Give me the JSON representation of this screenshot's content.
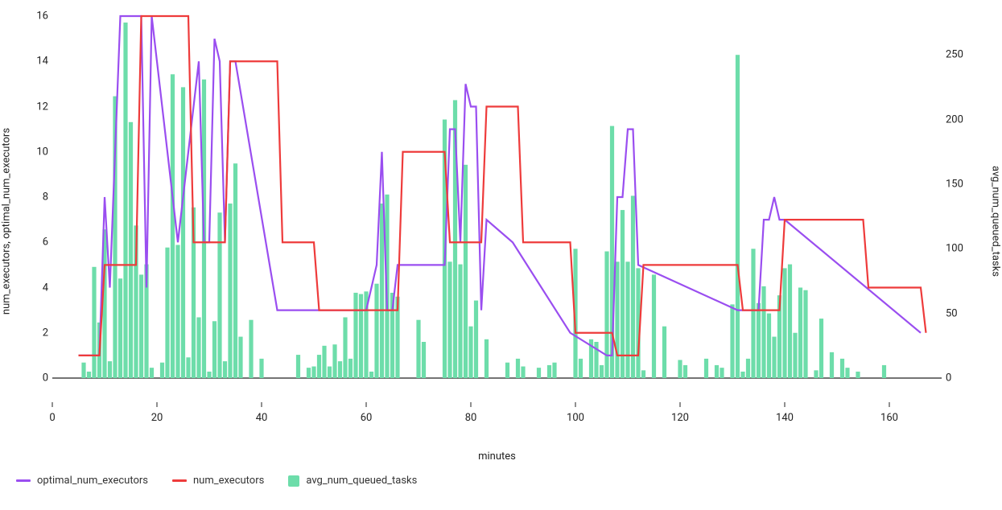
{
  "chart_data": {
    "type": "combo",
    "xlabel": "minutes",
    "ylabel_left": "num_executors, optimal_num_executors",
    "ylabel_right": "avg_num_queued_tasks",
    "y_left": {
      "min": 0,
      "max": 16,
      "ticks": [
        0,
        2,
        4,
        6,
        8,
        10,
        12,
        14,
        16
      ]
    },
    "y_right": {
      "min": 0,
      "max": 280,
      "ticks": [
        0,
        50,
        100,
        150,
        200,
        250
      ]
    },
    "x": {
      "min": 0,
      "max": 170,
      "ticks": [
        0,
        20,
        40,
        60,
        80,
        100,
        120,
        140,
        160
      ]
    },
    "series": [
      {
        "name": "avg_num_queued_tasks",
        "type": "bar",
        "axis": "right",
        "color": "#6dddaa",
        "x": [
          5,
          6,
          7,
          8,
          9,
          10,
          11,
          12,
          13,
          14,
          15,
          16,
          17,
          18,
          19,
          20,
          21,
          22,
          23,
          24,
          25,
          26,
          27,
          28,
          29,
          30,
          31,
          32,
          33,
          34,
          35,
          36,
          37,
          38,
          39,
          40,
          41,
          42,
          43,
          44,
          45,
          46,
          47,
          48,
          49,
          50,
          51,
          52,
          53,
          54,
          55,
          56,
          57,
          58,
          59,
          60,
          61,
          62,
          63,
          64,
          65,
          66,
          67,
          68,
          69,
          70,
          71,
          72,
          73,
          74,
          75,
          76,
          77,
          78,
          79,
          80,
          81,
          82,
          83,
          84,
          85,
          86,
          87,
          88,
          89,
          90,
          91,
          92,
          93,
          94,
          95,
          96,
          97,
          98,
          99,
          100,
          101,
          102,
          103,
          104,
          105,
          106,
          107,
          108,
          109,
          110,
          111,
          112,
          113,
          114,
          115,
          116,
          117,
          118,
          119,
          120,
          121,
          122,
          123,
          124,
          125,
          126,
          127,
          128,
          129,
          130,
          131,
          132,
          133,
          134,
          135,
          136,
          137,
          138,
          139,
          140,
          141,
          142,
          143,
          144,
          145,
          146,
          147,
          148,
          149,
          150,
          151,
          152,
          153,
          154,
          155,
          156,
          157,
          158,
          159,
          160
        ],
        "values": [
          0,
          12,
          5,
          86,
          43,
          115,
          13,
          218,
          77,
          275,
          198,
          118,
          80,
          88,
          8,
          0,
          12,
          101,
          235,
          103,
          225,
          16,
          132,
          47,
          231,
          5,
          44,
          128,
          13,
          135,
          166,
          32,
          0,
          45,
          0,
          15,
          0,
          0,
          0,
          0,
          0,
          0,
          18,
          0,
          8,
          9,
          18,
          25,
          9,
          26,
          13,
          47,
          15,
          66,
          65,
          67,
          5,
          73,
          135,
          142,
          66,
          63,
          0,
          0,
          0,
          45,
          28,
          0,
          0,
          0,
          200,
          90,
          215,
          88,
          165,
          40,
          60,
          0,
          30,
          0,
          0,
          0,
          12,
          0,
          15,
          9,
          0,
          0,
          8,
          0,
          10,
          12,
          0,
          0,
          0,
          100,
          15,
          0,
          30,
          28,
          10,
          98,
          195,
          90,
          130,
          90,
          141,
          85,
          6,
          0,
          80,
          0,
          40,
          0,
          0,
          14,
          10,
          0,
          0,
          0,
          15,
          0,
          10,
          8,
          0,
          57,
          250,
          5,
          15,
          100,
          58,
          71,
          50,
          32,
          64,
          85,
          88,
          35,
          70,
          68,
          0,
          6,
          46,
          0,
          20,
          0,
          15,
          8,
          0,
          5,
          0,
          0,
          0,
          0,
          10,
          0
        ]
      },
      {
        "name": "optimal_num_executors",
        "type": "line",
        "axis": "left",
        "color": "#9a4ef0",
        "x": [
          5,
          9,
          10,
          11,
          13,
          15,
          16,
          17,
          18,
          19,
          24,
          28,
          29,
          30,
          31,
          32,
          33,
          34,
          35,
          43,
          60,
          62,
          63,
          64,
          65,
          66,
          75,
          76,
          77,
          78,
          79,
          80,
          81,
          82,
          83,
          88,
          99,
          106,
          107,
          108,
          109,
          110,
          111,
          112,
          131,
          135,
          136,
          137,
          138,
          139,
          140,
          166
        ],
        "values": [
          1,
          1,
          8,
          4,
          16,
          16,
          16,
          16,
          4,
          16,
          6,
          14,
          6,
          6,
          15,
          14,
          6,
          14,
          14,
          3,
          3,
          5,
          10,
          3,
          3,
          5,
          5,
          11,
          11,
          6,
          13,
          12,
          12,
          3,
          7,
          6,
          2,
          1,
          1,
          8,
          8,
          11,
          11,
          5,
          3,
          3,
          7,
          7,
          8,
          7,
          7,
          2
        ]
      },
      {
        "name": "num_executors",
        "type": "line",
        "axis": "left",
        "color": "#ee3b3b",
        "x": [
          5,
          6,
          7,
          8,
          9,
          10,
          11,
          16,
          17,
          26,
          27,
          28,
          33,
          34,
          35,
          43,
          44,
          50,
          51,
          66,
          67,
          75,
          76,
          77,
          82,
          83,
          89,
          90,
          99,
          100,
          107,
          108,
          112,
          113,
          131,
          132,
          139,
          140,
          145,
          146,
          155,
          156,
          166,
          167
        ],
        "values": [
          1,
          1,
          1,
          1,
          1,
          5,
          5,
          5,
          16,
          16,
          6,
          6,
          6,
          14,
          14,
          14,
          6,
          6,
          3,
          3,
          10,
          10,
          6,
          6,
          6,
          12,
          12,
          6,
          6,
          2,
          2,
          1,
          1,
          5,
          5,
          3,
          3,
          7,
          7,
          7,
          7,
          4,
          4,
          2
        ]
      }
    ],
    "legend": [
      {
        "name": "optimal_num_executors",
        "color": "#9a4ef0",
        "type": "line"
      },
      {
        "name": "num_executors",
        "color": "#ee3b3b",
        "type": "line"
      },
      {
        "name": "avg_num_queued_tasks",
        "color": "#6dddaa",
        "type": "bar"
      }
    ]
  }
}
